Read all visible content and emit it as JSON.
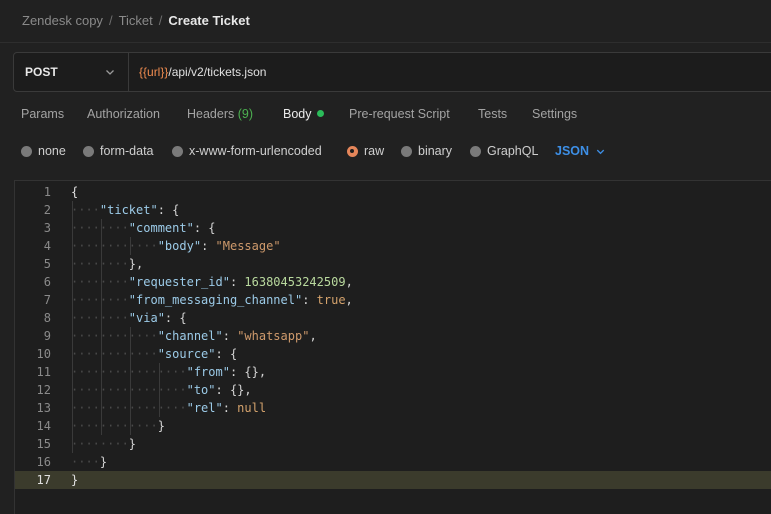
{
  "breadcrumb": {
    "collection": "Zendesk copy",
    "folder": "Ticket",
    "current": "Create Ticket",
    "separator": "/"
  },
  "request": {
    "method": "POST",
    "url_variable": "{{url}}",
    "url_path": "/api/v2/tickets.json"
  },
  "tabs": [
    {
      "label": "Params"
    },
    {
      "label": "Authorization"
    },
    {
      "label": "Headers",
      "count": "(9)"
    },
    {
      "label": "Body",
      "active": true
    },
    {
      "label": "Pre-request Script"
    },
    {
      "label": "Tests"
    },
    {
      "label": "Settings"
    }
  ],
  "body_types": [
    "none",
    "form-data",
    "x-www-form-urlencoded",
    "raw",
    "binary",
    "GraphQL"
  ],
  "body_type_selected": "raw",
  "language": "JSON",
  "code_lines": [
    {
      "n": "1",
      "indent": 0,
      "tokens": [
        {
          "t": "{",
          "c": "b"
        }
      ]
    },
    {
      "n": "2",
      "indent": 1,
      "tokens": [
        {
          "t": "\"ticket\"",
          "c": "k"
        },
        {
          "t": ": {",
          "c": "p"
        }
      ]
    },
    {
      "n": "3",
      "indent": 2,
      "tokens": [
        {
          "t": "\"comment\"",
          "c": "k"
        },
        {
          "t": ": {",
          "c": "p"
        }
      ]
    },
    {
      "n": "4",
      "indent": 3,
      "tokens": [
        {
          "t": "\"body\"",
          "c": "k"
        },
        {
          "t": ": ",
          "c": "p"
        },
        {
          "t": "\"Message\"",
          "c": "s"
        }
      ]
    },
    {
      "n": "5",
      "indent": 2,
      "tokens": [
        {
          "t": "},",
          "c": "p"
        }
      ]
    },
    {
      "n": "6",
      "indent": 2,
      "tokens": [
        {
          "t": "\"requester_id\"",
          "c": "k"
        },
        {
          "t": ": ",
          "c": "p"
        },
        {
          "t": "16380453242509",
          "c": "n"
        },
        {
          "t": ",",
          "c": "p"
        }
      ]
    },
    {
      "n": "7",
      "indent": 2,
      "tokens": [
        {
          "t": "\"from_messaging_channel\"",
          "c": "k"
        },
        {
          "t": ": ",
          "c": "p"
        },
        {
          "t": "true",
          "c": "lit"
        },
        {
          "t": ",",
          "c": "p"
        }
      ]
    },
    {
      "n": "8",
      "indent": 2,
      "tokens": [
        {
          "t": "\"via\"",
          "c": "k"
        },
        {
          "t": ": {",
          "c": "p"
        }
      ]
    },
    {
      "n": "9",
      "indent": 3,
      "tokens": [
        {
          "t": "\"channel\"",
          "c": "k"
        },
        {
          "t": ": ",
          "c": "p"
        },
        {
          "t": "\"whatsapp\"",
          "c": "s"
        },
        {
          "t": ",",
          "c": "p"
        }
      ]
    },
    {
      "n": "10",
      "indent": 3,
      "tokens": [
        {
          "t": "\"source\"",
          "c": "k"
        },
        {
          "t": ": {",
          "c": "p"
        }
      ]
    },
    {
      "n": "11",
      "indent": 4,
      "tokens": [
        {
          "t": "\"from\"",
          "c": "k"
        },
        {
          "t": ": {},",
          "c": "p"
        }
      ]
    },
    {
      "n": "12",
      "indent": 4,
      "tokens": [
        {
          "t": "\"to\"",
          "c": "k"
        },
        {
          "t": ": {},",
          "c": "p"
        }
      ]
    },
    {
      "n": "13",
      "indent": 4,
      "tokens": [
        {
          "t": "\"rel\"",
          "c": "k"
        },
        {
          "t": ": ",
          "c": "p"
        },
        {
          "t": "null",
          "c": "lit"
        }
      ]
    },
    {
      "n": "14",
      "indent": 3,
      "tokens": [
        {
          "t": "}",
          "c": "p"
        }
      ]
    },
    {
      "n": "15",
      "indent": 2,
      "tokens": [
        {
          "t": "}",
          "c": "p"
        }
      ]
    },
    {
      "n": "16",
      "indent": 1,
      "tokens": [
        {
          "t": "}",
          "c": "p"
        }
      ]
    },
    {
      "n": "17",
      "indent": 0,
      "current": true,
      "tokens": [
        {
          "t": "}",
          "c": "b"
        }
      ]
    }
  ],
  "colors": {
    "accent_orange": "#f08c50",
    "active_dot": "#2bbc5a",
    "json_select": "#3d8fe6"
  }
}
